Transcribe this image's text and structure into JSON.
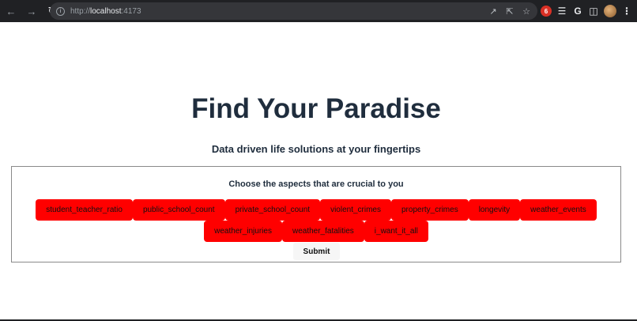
{
  "browser": {
    "url_scheme": "http://",
    "url_host": "localhost",
    "url_port": ":4173",
    "back_icon": "arrow-left",
    "forward_icon": "arrow-right",
    "reload_icon": "reload",
    "ext_red_label": "6",
    "ext_g_label": "G"
  },
  "page": {
    "title": "Find Your Paradise",
    "subtitle": "Data driven life solutions at your fingertips"
  },
  "panel": {
    "heading": "Choose the aspects that are crucial to you",
    "aspects_row1": [
      "student_teacher_ratio",
      "public_school_count",
      "private_school_count",
      "violent_crimes",
      "property_crimes",
      "longevity",
      "weather_events"
    ],
    "aspects_row2": [
      "weather_injuries",
      "weather_fatalities",
      "i_want_it_all"
    ],
    "submit_label": "Submit",
    "chip_color": "#ff0000"
  }
}
